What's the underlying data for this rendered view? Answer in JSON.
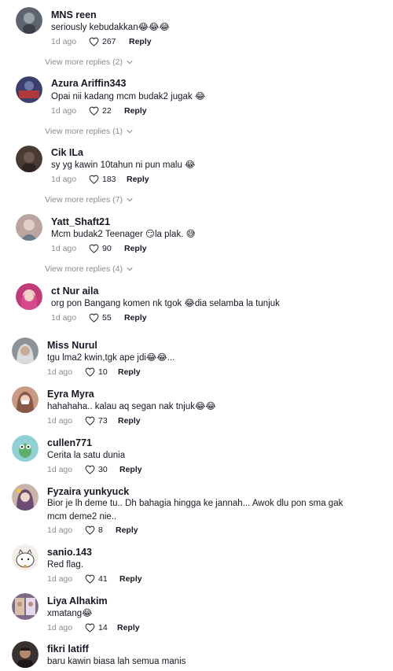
{
  "comments": [
    {
      "username": "MNS reen",
      "text": "seriously kebudakkan😂😂😂",
      "date": "1d ago",
      "likes": "267",
      "reply": "Reply",
      "view_more": "View more replies (2)",
      "avatar_color": "#5d6470"
    },
    {
      "username": "Azura Ariffin343",
      "text": "Opai nii kadang mcm budak2 jugak 😂",
      "date": "1d ago",
      "likes": "22",
      "reply": "Reply",
      "view_more": "View more replies (1)",
      "avatar_color": "#3b3f6e"
    },
    {
      "username": "Cik ILa",
      "text": "sy yg kawin 10tahun ni pun malu 😂",
      "date": "1d ago",
      "likes": "183",
      "reply": "Reply",
      "view_more": "View more replies (7)",
      "avatar_color": "#4a3a34"
    },
    {
      "username": "Yatt_Shaft21",
      "text": "Mcm budak2 Teenager 😏la plak. 😅",
      "date": "1d ago",
      "likes": "90",
      "reply": "Reply",
      "view_more": "View more replies (4)",
      "avatar_color": "#b9a49e"
    },
    {
      "username": "ct Nur aila",
      "text": "org pon Bangang komen nk tgok 😂dia selamba la tunjuk",
      "date": "1d ago",
      "likes": "55",
      "reply": "Reply",
      "avatar_color": "#c23a7a"
    },
    {
      "username": "Miss Nurul",
      "text": "tgu lma2 kwin,tgk ape jdi😂😂...",
      "date": "1d ago",
      "likes": "10",
      "reply": "Reply",
      "avatar_color": "#8c9396"
    },
    {
      "username": "Eyra Myra",
      "text": "hahahaha.. kalau aq segan nak tnjuk😂😂",
      "date": "1d ago",
      "likes": "73",
      "reply": "Reply",
      "avatar_color": "#c99a86"
    },
    {
      "username": "cullen771",
      "text": "Cerita la satu dunia",
      "date": "1d ago",
      "likes": "30",
      "reply": "Reply",
      "avatar_color": "#8fd0d4"
    },
    {
      "username": "Fyzaira yunkyuck",
      "text": "Bior je lh deme tu.. Dh bahagia hingga ke jannah... Awok dlu pon sma gak mcm deme2 nie..",
      "date": "1d ago",
      "likes": "8",
      "reply": "Reply",
      "avatar_color": "#c8b5a8"
    },
    {
      "username": "sanio.143",
      "text": "Red flag.",
      "date": "1d ago",
      "likes": "41",
      "reply": "Reply",
      "avatar_color": "#f3efe9"
    },
    {
      "username": "Liya Alhakim",
      "text": "xmatang😂",
      "date": "1d ago",
      "likes": "14",
      "reply": "Reply",
      "avatar_color": "#7c6a86"
    },
    {
      "username": "fikri latiff",
      "text": "baru kawin biasa lah semua manis",
      "avatar_color": "#3a3230"
    }
  ],
  "colors": {
    "muted": "#8a8b91",
    "text": "#161823",
    "background": "#ffffff"
  },
  "icons": {
    "like": "heart-outline-icon",
    "expand": "chevron-down-icon"
  }
}
